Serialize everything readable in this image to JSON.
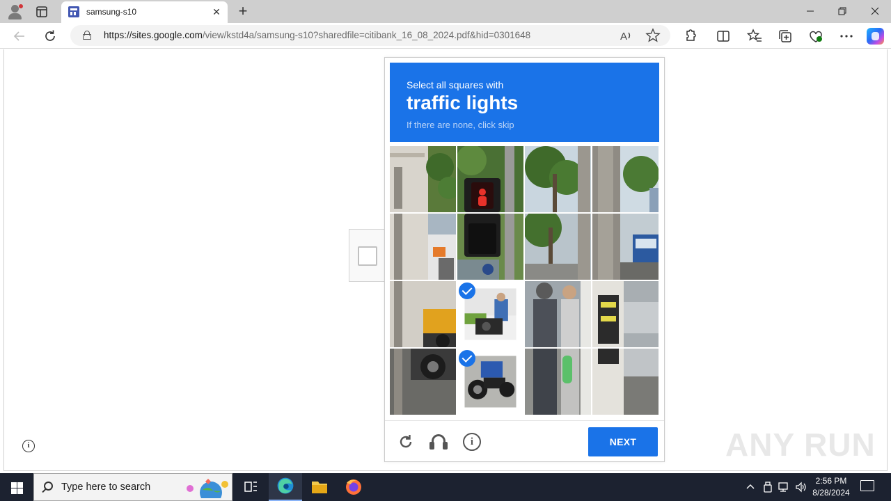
{
  "browser": {
    "tab_title": "samsung-s10",
    "url_host": "https://sites.google.com",
    "url_rest": "/view/kstd4a/samsung-s10?sharedfile=citibank_16_08_2024.pdf&hid=0301648",
    "new_tab_label": "+",
    "close_tab_label": "✕"
  },
  "captcha": {
    "instruction": "Select all squares with",
    "target": "traffic lights",
    "hint": "If there are none, click skip",
    "selected_tiles": [
      6,
      10
    ],
    "next_label": "NEXT",
    "accent_color": "#1a73e8"
  },
  "watermark": "ANY RUN",
  "taskbar": {
    "search_placeholder": "Type here to search",
    "time": "2:56 PM",
    "date": "8/28/2024"
  }
}
